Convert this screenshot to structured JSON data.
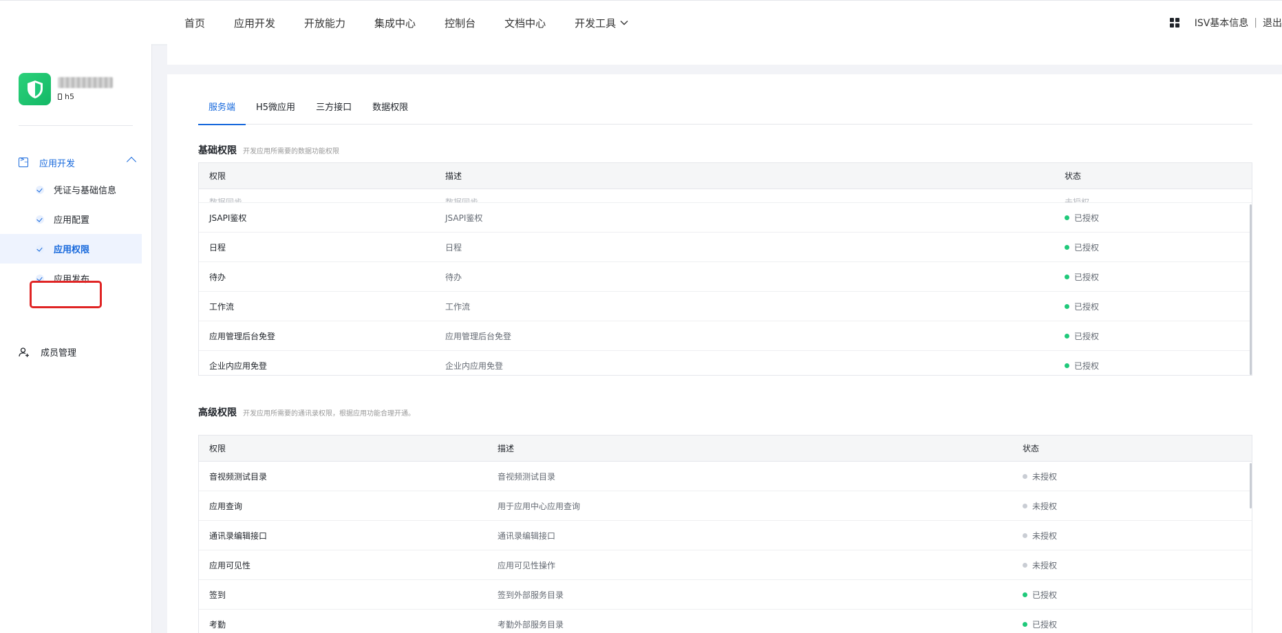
{
  "topnav": {
    "items": [
      "首页",
      "应用开发",
      "开放能力",
      "集成中心",
      "控制台",
      "文档中心",
      "开发工具"
    ],
    "isv_info": "ISV基本信息",
    "separator": "|",
    "logout": "退出"
  },
  "sidebar": {
    "app_type": "h5",
    "group_title": "应用开发",
    "sub_items": [
      "凭证与基础信息",
      "应用配置",
      "应用权限",
      "应用发布"
    ],
    "member": "成员管理"
  },
  "tabs": [
    "服务端",
    "H5微应用",
    "三方接口",
    "数据权限"
  ],
  "basic": {
    "title": "基础权限",
    "subtitle": "开发应用所需要的数据功能权限",
    "headers": [
      "权限",
      "描述",
      "状态"
    ],
    "partial_row": [
      "数据同步",
      "数据同步",
      "未授权"
    ],
    "rows": [
      {
        "name": "JSAPI鉴权",
        "desc": "JSAPI鉴权",
        "status": "已授权"
      },
      {
        "name": "日程",
        "desc": "日程",
        "status": "已授权"
      },
      {
        "name": "待办",
        "desc": "待办",
        "status": "已授权"
      },
      {
        "name": "工作流",
        "desc": "工作流",
        "status": "已授权"
      },
      {
        "name": "应用管理后台免登",
        "desc": "应用管理后台免登",
        "status": "已授权"
      },
      {
        "name": "企业内应用免登",
        "desc": "企业内应用免登",
        "status": "已授权"
      }
    ]
  },
  "advanced": {
    "title": "高级权限",
    "subtitle": "开发应用所需要的通讯录权限，根据应用功能合理开通。",
    "headers": [
      "权限",
      "描述",
      "状态"
    ],
    "rows": [
      {
        "name": "音视频测试目录",
        "desc": "音视频测试目录",
        "status": "未授权"
      },
      {
        "name": "应用查询",
        "desc": "用于应用中心应用查询",
        "status": "未授权"
      },
      {
        "name": "通讯录编辑接口",
        "desc": "通讯录编辑接口",
        "status": "未授权"
      },
      {
        "name": "应用可见性",
        "desc": "应用可见性操作",
        "status": "未授权"
      },
      {
        "name": "签到",
        "desc": "签到外部服务目录",
        "status": "已授权"
      },
      {
        "name": "考勤",
        "desc": "考勤外部服务目录",
        "status": "已授权"
      }
    ]
  },
  "colors": {
    "accent": "#1668dc",
    "granted": "#1fc97a",
    "not_granted": "#c9cdd4",
    "highlight": "#e02424"
  }
}
